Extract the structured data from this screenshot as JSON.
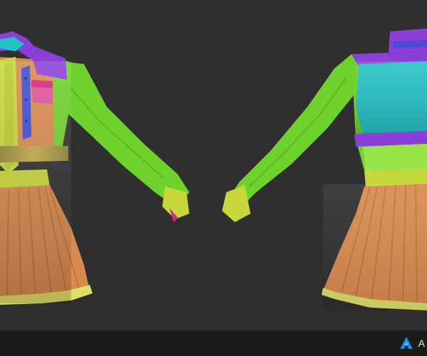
{
  "image": {
    "subject": "clothing",
    "views": [
      "front-three-quarter",
      "back-three-quarter"
    ],
    "background": "#2f2f2f",
    "footer_bar": "#1b1b1b"
  },
  "brand": {
    "logo_icon": "a-triangle-logo-icon",
    "text": "A",
    "color": "#1e88e5"
  },
  "palette": {
    "green": "#6fd12c",
    "orange": "#d98a4e",
    "yellowgreen": "#c7d83a",
    "purple": "#8b3fd6",
    "cyan": "#21c2c6",
    "magenta": "#d42a84",
    "blue": "#3d4bd6",
    "pale_yellow": "#e0de6a"
  }
}
